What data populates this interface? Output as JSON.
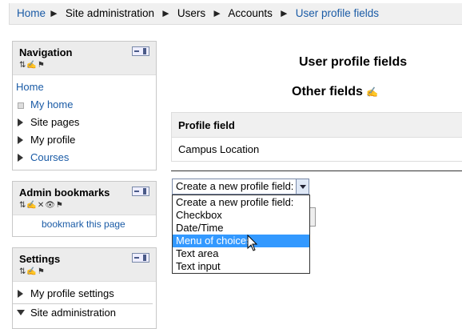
{
  "breadcrumb": {
    "items": [
      "Home",
      "Site administration",
      "Users",
      "Accounts",
      "User profile fields"
    ],
    "sep": "►"
  },
  "navigation": {
    "title": "Navigation",
    "icons": "⇅✍⚑",
    "home": "Home",
    "items": [
      "My home",
      "Site pages",
      "My profile",
      "Courses"
    ]
  },
  "admin_bookmarks": {
    "title": "Admin bookmarks",
    "icons": "⇅✍✕👁⚑",
    "link": "bookmark this page"
  },
  "settings": {
    "title": "Settings",
    "icons": "⇅✍⚑",
    "items": [
      "My profile settings",
      "Site administration"
    ]
  },
  "main": {
    "title": "User profile fields",
    "section": "Other fields",
    "edit_icon": "✍",
    "table_header": "Profile field",
    "row": "Campus Location",
    "select_value": "Create a new profile field:",
    "options": [
      "Create a new profile field:",
      "Checkbox",
      "Date/Time",
      "Menu of choices",
      "Text area",
      "Text input"
    ]
  }
}
